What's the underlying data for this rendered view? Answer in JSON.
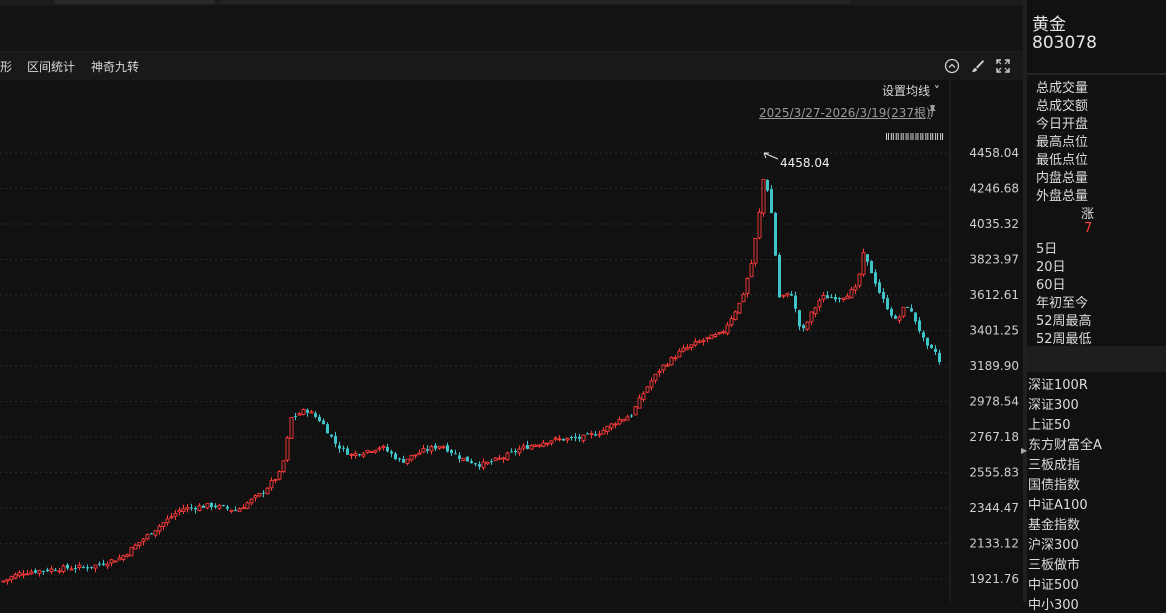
{
  "toolbar": {
    "items": [
      "形",
      "区间统计",
      "神奇九转"
    ],
    "icons": [
      "collapse-up-icon",
      "brush-icon",
      "fullscreen-icon"
    ]
  },
  "chart": {
    "ma_setting": "设置均线",
    "range": "2025/3/27-2026/3/19(237根)",
    "max_marker": "4458.04",
    "dots": "ⅡⅡⅡⅡⅡⅡⅡⅡⅡⅡⅡⅡ",
    "colors": {
      "up": "#ff3b3b",
      "down": "#3fc5c9",
      "grid": "#2a2a2a"
    }
  },
  "chart_data": {
    "type": "candlestick",
    "y_tick_labels": [
      "4458.04",
      "4246.68",
      "4035.32",
      "3823.97",
      "3612.61",
      "3401.25",
      "3189.90",
      "2978.54",
      "2767.18",
      "2555.83",
      "2344.47",
      "2133.12",
      "1921.76"
    ],
    "ylim": [
      1850,
      4520
    ],
    "period": "2025/3/27-2026/3/19",
    "bar_count": 237,
    "max": 4458.04
  },
  "side": {
    "name": "黄金",
    "code": "803078",
    "stats": [
      "总成交量",
      "总成交额",
      "今日开盘",
      "最高点位",
      "最低点位",
      "内盘总量",
      "外盘总量"
    ],
    "zhang_label": "涨",
    "zhang_value": "7",
    "periods": [
      "5日",
      "20日",
      "60日",
      "年初至今",
      "52周最高",
      "52周最低"
    ],
    "indices": [
      "深证100R",
      "深证300",
      "上证50",
      "东方财富全A",
      "三板成指",
      "国债指数",
      "中证A100",
      "基金指数",
      "沪深300",
      "三板做市",
      "中证500",
      "中小300"
    ]
  }
}
